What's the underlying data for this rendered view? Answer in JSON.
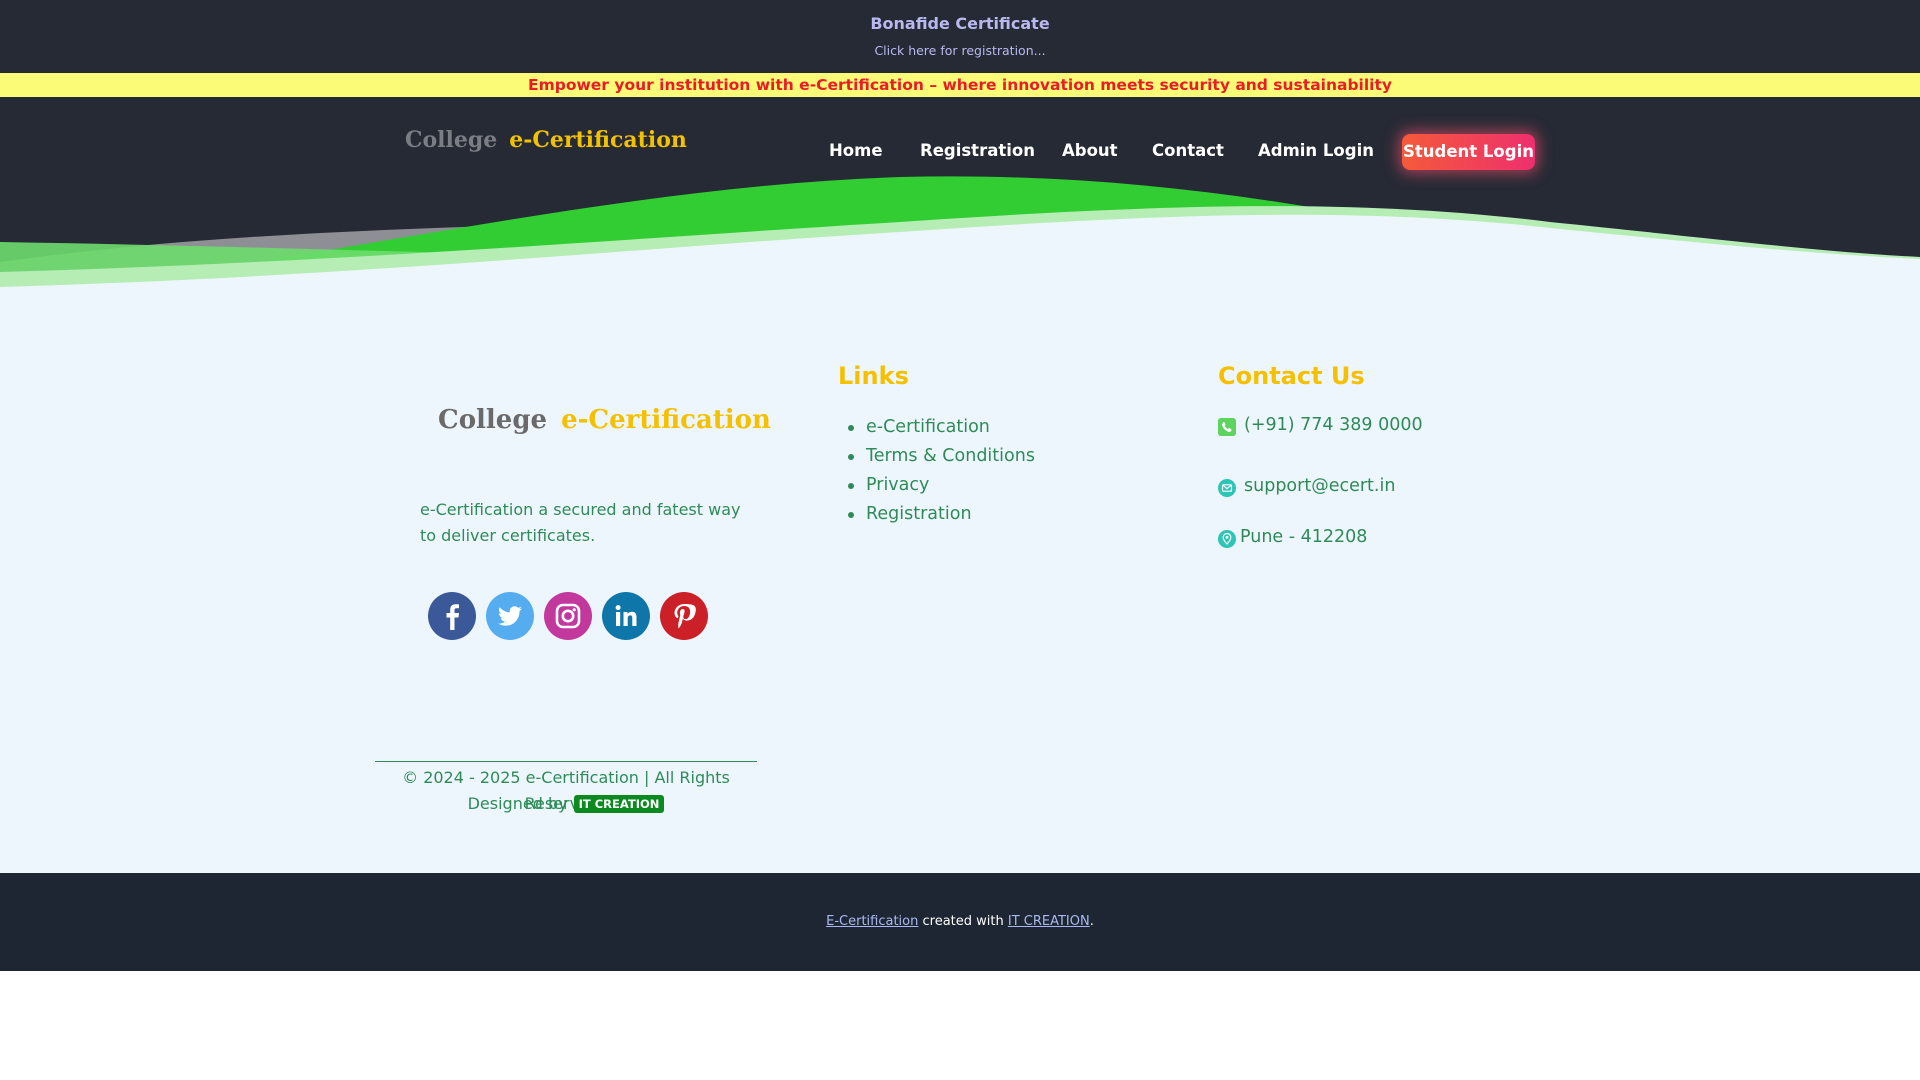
{
  "topbar": {
    "title": "Bonafide Certificate",
    "registration_link": "Click here for registration..."
  },
  "marquee": {
    "text": "Empower your institution with e-Certification – where innovation meets security and sustainability"
  },
  "header": {
    "brand_part1": "College",
    "brand_part2": "e-Certification",
    "nav": {
      "home": "Home",
      "registration": "Registration",
      "about": "About",
      "contact": "Contact",
      "admin_login": "Admin Login",
      "student_login": "Student Login"
    }
  },
  "footer": {
    "brand_part1": "College",
    "brand_part2": "e-Certification",
    "description": "e-Certification a secured and fatest way to deliver certificates.",
    "socials": [
      "facebook-icon",
      "twitter-icon",
      "instagram-icon",
      "linkedin-icon",
      "pinterest-icon"
    ],
    "links_title": "Links",
    "links": [
      "e-Certification",
      "Terms & Conditions",
      "Privacy",
      "Registration"
    ],
    "contact_title": "Contact Us",
    "contact": {
      "phone": "(+91) 774 389 0000",
      "email": "support@ecert.in",
      "location": "Pune - 412208"
    },
    "copyright": "© 2024 - 2025 e-Certification | All Rights Reserveds",
    "designed_by_label": "Designed by",
    "designed_by_badge": "IT CREATION"
  },
  "bottom_bar": {
    "link1": "E-Certification",
    "middle_text": " created with ",
    "link2": "IT CREATION",
    "end_text": "."
  },
  "colors": {
    "dark_bg": "#262a35",
    "marquee_bg": "#fbfb78",
    "marquee_text": "#ea1c24",
    "accent_yellow": "#f5c000",
    "text_green": "#2e8b57",
    "footer_bg": "#eef6fd",
    "bottom_bg": "#1e2633"
  }
}
